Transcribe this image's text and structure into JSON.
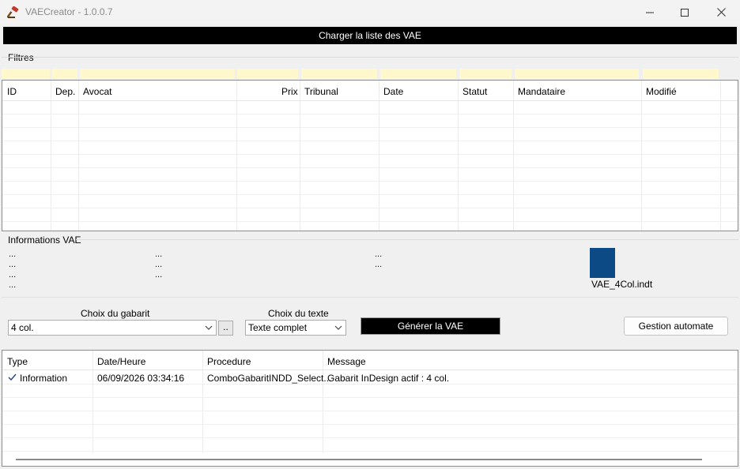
{
  "window": {
    "title": "VAECreator - 1.0.0.7",
    "icon": "gavel-icon",
    "controls": [
      "minimize-icon",
      "maximize-icon",
      "close-icon"
    ]
  },
  "toolbar": {
    "load_label": "Charger la liste des VAE"
  },
  "filters": {
    "label": "Filtres"
  },
  "grid": {
    "columns": [
      "ID",
      "Dep.",
      "Avocat",
      "Prix",
      "Tribunal",
      "Date",
      "Statut",
      "Mandataire",
      "Modifié"
    ],
    "rows": []
  },
  "info": {
    "label": "Informations VAE",
    "col1": [
      "...",
      "...",
      "...",
      "..."
    ],
    "col2": [
      "...",
      "...",
      "..."
    ],
    "col3": [
      "...",
      "..."
    ],
    "template_file": "VAE_4Col.indt",
    "thumb_color": "#0b4a85"
  },
  "controls": {
    "gabarit_label": "Choix du gabarit",
    "gabarit_value": "4 col.",
    "browse_label": "..",
    "texte_label": "Choix du texte",
    "texte_value": "Texte complet",
    "generate_label": "Générer la VAE",
    "automate_label": "Gestion automate"
  },
  "log": {
    "columns": [
      "Type",
      "Date/Heure",
      "Procedure",
      "Message"
    ],
    "rows": [
      {
        "type": "Information",
        "datetime": "06/09/2026 03:34:16",
        "procedure": "ComboGabaritINDD_Select...",
        "message": "Gabarit InDesign actif : 4 col."
      }
    ]
  }
}
